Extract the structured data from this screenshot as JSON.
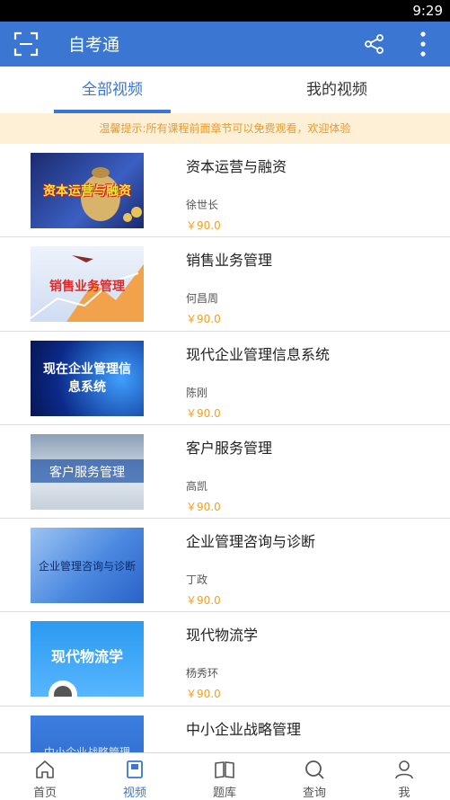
{
  "status_bar": {
    "time": "9:29"
  },
  "app_bar": {
    "title": "自考通",
    "scan_icon": "scan-icon",
    "share_icon": "share-icon",
    "more_icon": "more-vertical-icon"
  },
  "tabs": [
    {
      "label": "全部视频",
      "active": true
    },
    {
      "label": "我的视频",
      "active": false
    }
  ],
  "notice": "温馨提示:所有课程前面章节可以免费观看，欢迎体验",
  "courses": [
    {
      "title": "资本运营与融资",
      "teacher": "徐世长",
      "price": "￥90.0",
      "thumb_text": "资本运营与融资"
    },
    {
      "title": "销售业务管理",
      "teacher": "何昌周",
      "price": "￥90.0",
      "thumb_text": "销售业务管理"
    },
    {
      "title": "现代企业管理信息系统",
      "teacher": "陈刚",
      "price": "￥90.0",
      "thumb_text": "现在企业管理信息系统"
    },
    {
      "title": "客户服务管理",
      "teacher": "高凯",
      "price": "￥90.0",
      "thumb_text": "客户服务管理"
    },
    {
      "title": "企业管理咨询与诊断",
      "teacher": "丁政",
      "price": "￥90.0",
      "thumb_text": "企业管理咨询与诊断"
    },
    {
      "title": "现代物流学",
      "teacher": "杨秀环",
      "price": "￥90.0",
      "thumb_text": "现代物流学"
    },
    {
      "title": "中小企业战略管理",
      "teacher": "",
      "price": "",
      "thumb_text": "中小企业战略管理"
    }
  ],
  "bottom_nav": [
    {
      "label": "首页",
      "icon": "home-icon",
      "active": false
    },
    {
      "label": "视频",
      "icon": "video-icon",
      "active": true
    },
    {
      "label": "题库",
      "icon": "book-icon",
      "active": false
    },
    {
      "label": "查询",
      "icon": "search-icon",
      "active": false
    },
    {
      "label": "我",
      "icon": "user-icon",
      "active": false
    }
  ],
  "colors": {
    "primary": "#3a76d2",
    "price": "#f0a020",
    "notice_bg": "#fdf0d7",
    "notice_text": "#e89a2e"
  }
}
